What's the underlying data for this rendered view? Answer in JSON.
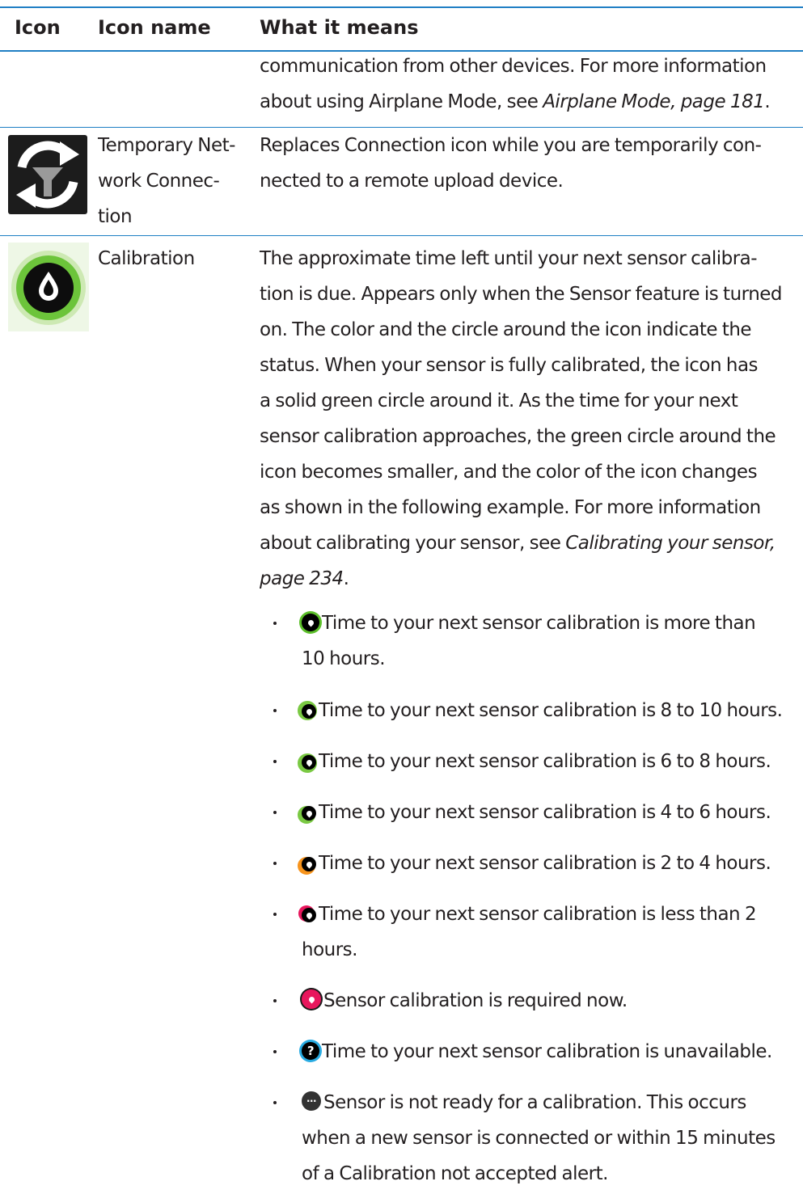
{
  "header": {
    "col_icon": "Icon",
    "col_name": "Icon name",
    "col_meaning": "What it means"
  },
  "continued": {
    "line1": "communication from other devices. For more information",
    "line2_prefix": "about using Airplane Mode, see ",
    "line2_link": "Airplane Mode, page 181",
    "line2_suffix": "."
  },
  "temp_network": {
    "name_lines": [
      "Temporary Net-",
      "work Connec-",
      "tion"
    ],
    "meaning_lines": [
      "Replaces Connection icon while you are temporarily con-",
      "nected to a remote upload device."
    ],
    "icon": "sync-filter-icon"
  },
  "calibration": {
    "name": "Calibration",
    "icon": "calibration-drop-icon",
    "meaning_lines": [
      "The approximate time left until your next sensor calibra-",
      "tion is due. Appears only when the Sensor feature is turned",
      "on. The color and the circle around the icon indicate the",
      "status. When your sensor is fully calibrated, the icon has",
      "a solid green circle around it. As the time for your next",
      "sensor calibration approaches, the green circle around the",
      "icon becomes smaller, and the color of the icon changes",
      "as shown in the following example. For more information"
    ],
    "ref_prefix": "about calibrating your sensor, see ",
    "ref_link_1": "Calibrating your sensor,",
    "ref_link_2": "page 234",
    "ref_suffix": ".",
    "bullets": [
      {
        "lines": [
          "Time to your next sensor calibration is more than",
          "10 hours."
        ],
        "icon": "calibration-green-full-icon",
        "color": "#5cbf2a"
      },
      {
        "lines": [
          "Time to your next sensor calibration is 8 to 10 hours."
        ],
        "icon": "calibration-green-icon",
        "color": "#7ac943"
      },
      {
        "lines": [
          "Time to your next sensor calibration is 6 to 8 hours."
        ],
        "icon": "calibration-green-icon",
        "color": "#7ac943"
      },
      {
        "lines": [
          "Time to your next sensor calibration is 4 to 6 hours."
        ],
        "icon": "calibration-green-icon",
        "color": "#7ac943"
      },
      {
        "lines": [
          "Time to your next sensor calibration is 2 to 4 hours."
        ],
        "icon": "calibration-orange-icon",
        "color": "#f7941d"
      },
      {
        "lines": [
          "Time to your next sensor calibration is less than 2",
          "hours."
        ],
        "icon": "calibration-red-low-icon",
        "color": "#e8175d"
      },
      {
        "lines": [
          "Sensor calibration is required now."
        ],
        "icon": "calibration-required-icon",
        "color": "#e8175d"
      },
      {
        "lines": [
          "Time to your next sensor calibration is unavailable."
        ],
        "icon": "calibration-unavailable-icon",
        "color": "#29abe2"
      },
      {
        "lines": [
          "Sensor is not ready for a calibration. This occurs",
          "when a new sensor is connected or within 15 minutes",
          "of a Calibration not accepted alert."
        ],
        "icon": "calibration-not-ready-icon",
        "color": "#333333"
      }
    ]
  }
}
